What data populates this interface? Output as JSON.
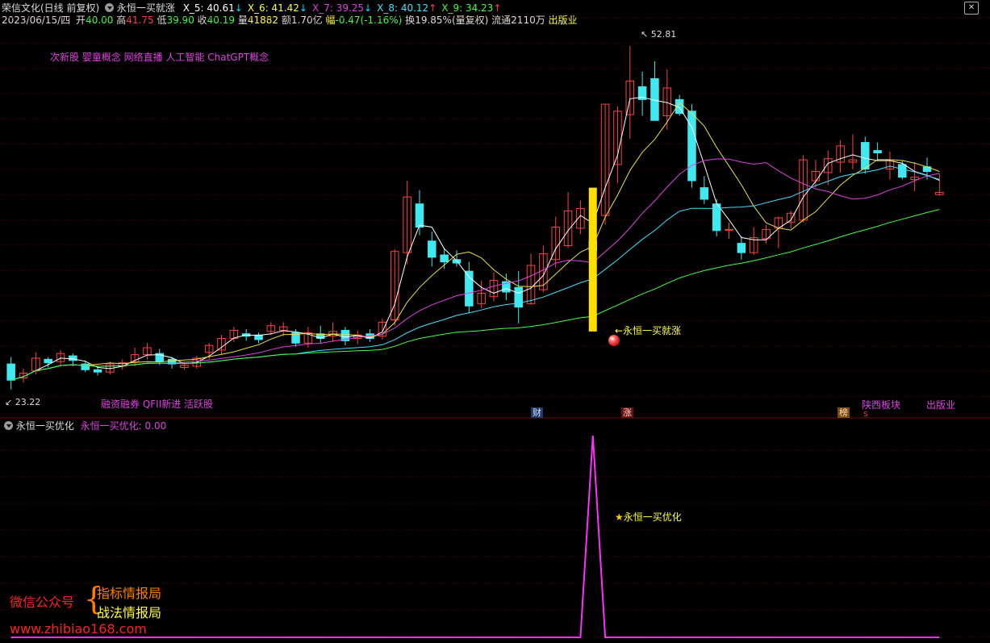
{
  "header": {
    "stock_name": "荣信文化(日线 前复权)",
    "indicator": "永恒一买就涨",
    "ma_items": [
      {
        "label": "X_5: 40.61",
        "arrow": "↓",
        "color": "#ffffff",
        "arrow_color": "#00e0ff"
      },
      {
        "label": "X_6: 41.42",
        "arrow": "↓",
        "color": "#ffff40",
        "arrow_color": "#00e0ff"
      },
      {
        "label": "X_7: 39.25",
        "arrow": "↓",
        "color": "#e040e0",
        "arrow_color": "#00e0ff"
      },
      {
        "label": "X_8: 40.12",
        "arrow": "↑",
        "color": "#40e0ff",
        "arrow_color": "#ff4040"
      },
      {
        "label": "X_9: 34.23",
        "arrow": "↑",
        "color": "#40ff40",
        "arrow_color": "#ff4040"
      }
    ],
    "close_icon": "close-icon"
  },
  "quote": {
    "date": "2023/06/15/四",
    "open_label": "开",
    "open": "40.00",
    "high_label": "高",
    "high": "41.75",
    "low_label": "低",
    "low": "39.90",
    "close_label": "收",
    "close": "40.19",
    "vol_label": "量",
    "vol": "41882",
    "amt_label": "额",
    "amt": "1.70亿",
    "chg_label": "幅",
    "chg": "-0.47(-1.16%)",
    "turn_label": "换",
    "turn": "19.85%(量复权)",
    "float_label": "流通",
    "float": "2110万",
    "sector": "出版业"
  },
  "concepts": "次新股 婴童概念 网络直播 人工智能 ChatGPT概念",
  "annotations": {
    "high_price": "52.81",
    "low_price": "23.22",
    "signal_label": "←永恒一买就涨",
    "bottom_tags": "融资融券 QFII新进 活跃股",
    "mark_cai": "财",
    "mark_zhang": "涨",
    "mark_bang": "榜",
    "mark_s": "s",
    "region_tag": "陕西板块",
    "industry_tag": "出版业"
  },
  "sub": {
    "title": "永恒一买优化",
    "value_label": "永恒一买优化: 0.00",
    "peak_label": "永恒一买优化",
    "star": "★"
  },
  "watermark": {
    "wechat": "微信公众号",
    "line1": "指标情报局",
    "line2": "战法情报局",
    "url": "www.zhibiao168.com"
  },
  "colors": {
    "up": "#ff4040",
    "down": "#40e8f0",
    "ma5": "#ffffff",
    "ma6": "#e8e040",
    "ma7": "#e040e0",
    "ma8": "#40e0ff",
    "ma9": "#40ff40",
    "signal_bar": "#ffe000",
    "sub_line": "#ff30ff"
  },
  "chart_data": {
    "type": "candlestick",
    "y_range": [
      22,
      54
    ],
    "candles": [
      {
        "o": 25.4,
        "h": 26.0,
        "l": 23.2,
        "c": 24.0
      },
      {
        "o": 24.2,
        "h": 25.0,
        "l": 23.8,
        "c": 24.6
      },
      {
        "o": 24.8,
        "h": 26.4,
        "l": 24.5,
        "c": 25.9
      },
      {
        "o": 25.8,
        "h": 26.0,
        "l": 25.1,
        "c": 25.5
      },
      {
        "o": 25.6,
        "h": 26.6,
        "l": 25.3,
        "c": 26.3
      },
      {
        "o": 26.1,
        "h": 26.3,
        "l": 25.2,
        "c": 25.7
      },
      {
        "o": 25.4,
        "h": 25.7,
        "l": 24.7,
        "c": 24.9
      },
      {
        "o": 24.9,
        "h": 25.2,
        "l": 24.4,
        "c": 24.7
      },
      {
        "o": 24.7,
        "h": 25.6,
        "l": 24.5,
        "c": 25.4
      },
      {
        "o": 25.2,
        "h": 25.8,
        "l": 24.9,
        "c": 25.5
      },
      {
        "o": 25.6,
        "h": 26.8,
        "l": 25.2,
        "c": 26.2
      },
      {
        "o": 26.2,
        "h": 27.2,
        "l": 25.8,
        "c": 26.8
      },
      {
        "o": 26.3,
        "h": 26.7,
        "l": 25.3,
        "c": 25.6
      },
      {
        "o": 25.8,
        "h": 26.0,
        "l": 25.0,
        "c": 25.4
      },
      {
        "o": 25.1,
        "h": 25.6,
        "l": 24.9,
        "c": 25.3
      },
      {
        "o": 25.2,
        "h": 26.1,
        "l": 25.0,
        "c": 25.9
      },
      {
        "o": 26.4,
        "h": 27.2,
        "l": 25.8,
        "c": 27.0
      },
      {
        "o": 26.6,
        "h": 27.9,
        "l": 26.2,
        "c": 27.6
      },
      {
        "o": 27.6,
        "h": 28.6,
        "l": 27.3,
        "c": 28.3
      },
      {
        "o": 28.0,
        "h": 28.4,
        "l": 27.4,
        "c": 27.8
      },
      {
        "o": 27.9,
        "h": 28.1,
        "l": 27.2,
        "c": 27.5
      },
      {
        "o": 28.2,
        "h": 29.0,
        "l": 27.9,
        "c": 28.7
      },
      {
        "o": 28.3,
        "h": 29.0,
        "l": 27.8,
        "c": 28.6
      },
      {
        "o": 28.1,
        "h": 28.4,
        "l": 26.9,
        "c": 27.2
      },
      {
        "o": 27.2,
        "h": 28.6,
        "l": 26.8,
        "c": 28.1
      },
      {
        "o": 28.0,
        "h": 28.7,
        "l": 27.2,
        "c": 27.6
      },
      {
        "o": 27.8,
        "h": 29.0,
        "l": 27.3,
        "c": 28.2
      },
      {
        "o": 28.3,
        "h": 28.6,
        "l": 27.0,
        "c": 27.4
      },
      {
        "o": 27.6,
        "h": 28.3,
        "l": 27.1,
        "c": 27.9
      },
      {
        "o": 28.0,
        "h": 28.4,
        "l": 27.3,
        "c": 27.6
      },
      {
        "o": 27.8,
        "h": 29.3,
        "l": 27.5,
        "c": 29.0
      },
      {
        "o": 29.2,
        "h": 35.3,
        "l": 28.7,
        "c": 35.1
      },
      {
        "o": 35.0,
        "h": 41.2,
        "l": 34.0,
        "c": 39.8
      },
      {
        "o": 39.2,
        "h": 40.4,
        "l": 36.5,
        "c": 37.2
      },
      {
        "o": 36.0,
        "h": 36.8,
        "l": 33.8,
        "c": 34.6
      },
      {
        "o": 34.8,
        "h": 35.4,
        "l": 33.6,
        "c": 34.2
      },
      {
        "o": 34.4,
        "h": 35.2,
        "l": 33.8,
        "c": 34.1
      },
      {
        "o": 33.4,
        "h": 34.2,
        "l": 29.8,
        "c": 30.4
      },
      {
        "o": 30.6,
        "h": 32.6,
        "l": 30.2,
        "c": 31.5
      },
      {
        "o": 31.2,
        "h": 33.3,
        "l": 30.8,
        "c": 32.6
      },
      {
        "o": 32.5,
        "h": 33.2,
        "l": 30.9,
        "c": 31.6
      },
      {
        "o": 32.0,
        "h": 33.4,
        "l": 28.9,
        "c": 30.3
      },
      {
        "o": 30.6,
        "h": 34.9,
        "l": 30.5,
        "c": 33.9
      },
      {
        "o": 31.8,
        "h": 35.6,
        "l": 31.6,
        "c": 34.9
      },
      {
        "o": 34.4,
        "h": 38.1,
        "l": 33.7,
        "c": 37.2
      },
      {
        "o": 35.6,
        "h": 40.2,
        "l": 35.4,
        "c": 38.6
      },
      {
        "o": 37.1,
        "h": 39.5,
        "l": 36.6,
        "c": 38.8
      },
      {
        "o": 36.0,
        "h": 36.9,
        "l": 35.1,
        "c": 35.2
      },
      {
        "o": 38.2,
        "h": 45.2,
        "l": 37.4,
        "c": 47.8
      },
      {
        "o": 42.6,
        "h": 47.6,
        "l": 41.0,
        "c": 47.2
      },
      {
        "o": 46.9,
        "h": 52.8,
        "l": 44.8,
        "c": 49.8
      },
      {
        "o": 49.3,
        "h": 50.6,
        "l": 46.8,
        "c": 48.2
      },
      {
        "o": 50.0,
        "h": 51.5,
        "l": 46.6,
        "c": 46.4
      },
      {
        "o": 46.8,
        "h": 50.8,
        "l": 45.6,
        "c": 49.2
      },
      {
        "o": 48.2,
        "h": 48.6,
        "l": 46.8,
        "c": 47.0
      },
      {
        "o": 47.2,
        "h": 47.8,
        "l": 40.6,
        "c": 41.2
      },
      {
        "o": 40.6,
        "h": 41.6,
        "l": 39.2,
        "c": 39.6
      },
      {
        "o": 39.2,
        "h": 39.6,
        "l": 36.4,
        "c": 36.9
      },
      {
        "o": 37.0,
        "h": 37.6,
        "l": 36.2,
        "c": 37.0
      },
      {
        "o": 35.8,
        "h": 36.4,
        "l": 34.4,
        "c": 35.0
      },
      {
        "o": 35.0,
        "h": 37.2,
        "l": 34.8,
        "c": 36.3
      },
      {
        "o": 36.2,
        "h": 37.4,
        "l": 35.8,
        "c": 37.0
      },
      {
        "o": 37.1,
        "h": 38.1,
        "l": 35.4,
        "c": 38.0
      },
      {
        "o": 37.6,
        "h": 38.6,
        "l": 37.1,
        "c": 38.4
      },
      {
        "o": 37.8,
        "h": 43.4,
        "l": 37.6,
        "c": 43.0
      },
      {
        "o": 41.2,
        "h": 43.0,
        "l": 40.6,
        "c": 42.0
      },
      {
        "o": 41.9,
        "h": 43.8,
        "l": 40.8,
        "c": 43.1
      },
      {
        "o": 42.8,
        "h": 44.7,
        "l": 41.9,
        "c": 44.2
      },
      {
        "o": 42.8,
        "h": 45.2,
        "l": 42.2,
        "c": 43.0
      },
      {
        "o": 44.5,
        "h": 45.0,
        "l": 41.8,
        "c": 42.2
      },
      {
        "o": 43.8,
        "h": 44.5,
        "l": 42.9,
        "c": 43.6
      },
      {
        "o": 42.2,
        "h": 43.7,
        "l": 41.3,
        "c": 43.0
      },
      {
        "o": 42.6,
        "h": 42.9,
        "l": 41.3,
        "c": 41.5
      },
      {
        "o": 41.3,
        "h": 42.8,
        "l": 40.3,
        "c": 41.5
      },
      {
        "o": 42.4,
        "h": 43.2,
        "l": 41.3,
        "c": 42.0
      },
      {
        "o": 40.0,
        "h": 41.8,
        "l": 39.9,
        "c": 40.2
      }
    ],
    "signal_index": 47,
    "sub_spike_index": 47,
    "sub_range": [
      0,
      1
    ]
  }
}
